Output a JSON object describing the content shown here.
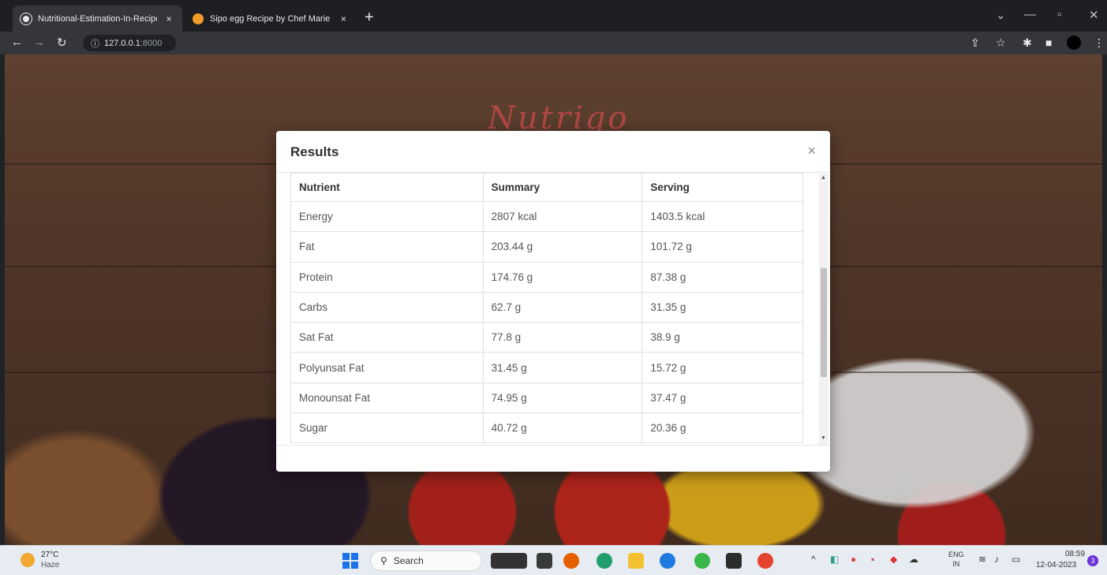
{
  "browser": {
    "tabs": [
      {
        "title": "Nutritional-Estimation-In-Recipe",
        "active": true,
        "icon": "globe-icon"
      },
      {
        "title": "Sipo egg Recipe by Chef Marie R",
        "active": false,
        "icon": "chef-favicon-icon"
      }
    ],
    "new_tab": "+",
    "close_glyph": "×",
    "address": {
      "host": "127.0.0.1",
      "port": ":8000"
    }
  },
  "page": {
    "brand": "Nutrigo"
  },
  "modal": {
    "title": "Results",
    "close": "×",
    "columns": [
      "Nutrient",
      "Summary",
      "Serving"
    ],
    "rows": [
      [
        "Energy",
        "2807 kcal",
        "1403.5 kcal"
      ],
      [
        "Fat",
        "203.44 g",
        "101.72 g"
      ],
      [
        "Protein",
        "174.76 g",
        "87.38 g"
      ],
      [
        "Carbs",
        "62.7 g",
        "31.35 g"
      ],
      [
        "Sat Fat",
        "77.8 g",
        "38.9 g"
      ],
      [
        "Polyunsat Fat",
        "31.45 g",
        "15.72 g"
      ],
      [
        "Monounsat Fat",
        "74.95 g",
        "37.47 g"
      ],
      [
        "Sugar",
        "40.72 g",
        "20.36 g"
      ]
    ]
  },
  "taskbar": {
    "weather": {
      "temp": "27°C",
      "condition": "Haze"
    },
    "search_label": "Search",
    "language": {
      "line1": "ENG",
      "line2": "IN"
    },
    "clock": {
      "time": "08:59",
      "date": "12-04-2023"
    },
    "notification_count": "3"
  },
  "colors": {
    "brand": "#c9514e",
    "tab_bar": "#1e1f22",
    "active_tab": "#35363a",
    "taskbar": "#e7ecf2"
  }
}
